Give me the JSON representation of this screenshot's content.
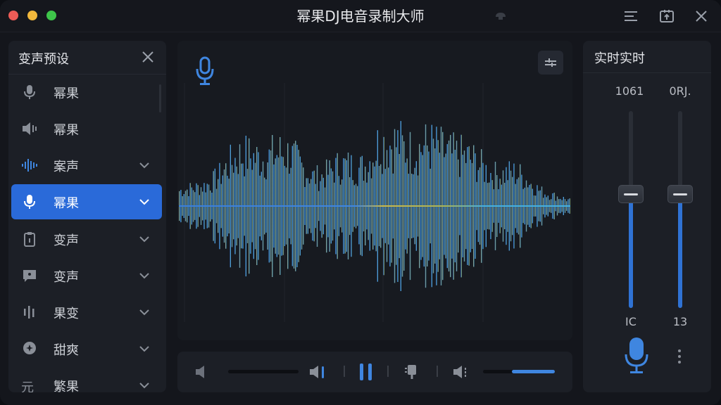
{
  "window": {
    "title": "幂果DJ电音录制大师"
  },
  "titlebar": {
    "icons": [
      "menu-icon",
      "export-icon",
      "close-icon"
    ]
  },
  "left_panel": {
    "title": "变声预设",
    "presets": [
      {
        "label": "幂果",
        "icon": "microphone-icon",
        "active": false,
        "chevron": false
      },
      {
        "label": "幂果",
        "icon": "speaker-icon",
        "active": false,
        "chevron": false
      },
      {
        "label": "案声",
        "icon": "waveform-icon",
        "active": false,
        "chevron": true
      },
      {
        "label": "幂果",
        "icon": "microphone-icon",
        "active": true,
        "chevron": true
      },
      {
        "label": "变声",
        "icon": "clipboard-icon",
        "active": false,
        "chevron": true
      },
      {
        "label": "变声",
        "icon": "chat-icon",
        "active": false,
        "chevron": true
      },
      {
        "label": "果变",
        "icon": "bars-icon",
        "active": false,
        "chevron": true
      },
      {
        "label": "甜爽",
        "icon": "badge-icon",
        "active": false,
        "chevron": true
      },
      {
        "label": "繁果",
        "icon": "text-icon",
        "active": false,
        "chevron": true
      }
    ],
    "preset_text_icon": "元"
  },
  "wave_panel": {
    "mic_icon": "microphone-icon",
    "adjust_icon": "adjust-icon",
    "colors": {
      "wave_blue": "#3f86e0",
      "wave_yellow": "#c9b84a",
      "wave_cyan": "#44b0e0"
    }
  },
  "transport": {
    "icons": [
      "volume-mute-icon",
      "volume-icon",
      "pause-icon",
      "record-icon",
      "volume-up-icon"
    ],
    "left_slider_level": 0.0,
    "right_slider_level": 0.6
  },
  "right_panel": {
    "title": "实时实时",
    "faders": [
      {
        "top_label": "1061",
        "bottom_label": "IC",
        "level": 0.58
      },
      {
        "top_label": "0RJ.",
        "bottom_label": "13",
        "level": 0.58
      }
    ],
    "mic_icon": "microphone-icon",
    "more_icon": "more-vertical-icon"
  },
  "colors": {
    "accent": "#2a6ad9",
    "background": "#14161c",
    "panel": "#1c1f26"
  }
}
